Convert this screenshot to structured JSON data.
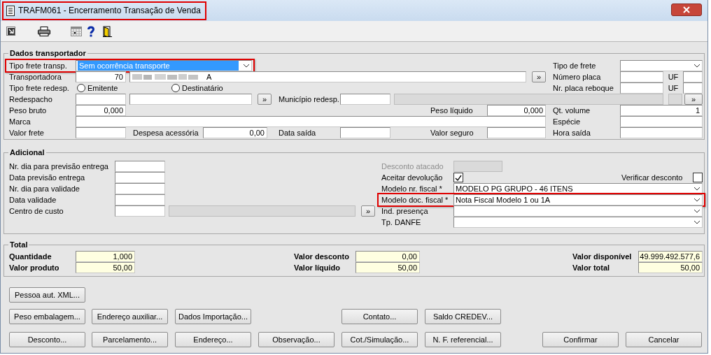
{
  "window": {
    "title": "TRAFM061 - Encerramento Transação de Venda",
    "highlighted": true
  },
  "sections": [
    {
      "title": "Dados transportador",
      "rows": [
        {
          "items": [
            {
              "kind": "label",
              "text": "Tipo frete transp."
            },
            {
              "kind": "combo",
              "value": "Sem ocorrência transporte",
              "selected": true,
              "highlighted": true
            },
            {
              "kind": "label",
              "text": "Tipo de frete"
            },
            {
              "kind": "combo",
              "highlighted": false
            }
          ]
        },
        {
          "items": [
            {
              "kind": "label",
              "text": "Transportadora"
            },
            {
              "kind": "input",
              "value": "70",
              "disabled": false
            },
            {
              "kind": "redacted",
              "value": "A"
            },
            {
              "kind": "button",
              "text": "»"
            },
            {
              "kind": "label",
              "text": "Número placa"
            },
            {
              "kind": "input",
              "disabled": false
            },
            {
              "kind": "label",
              "text": "UF"
            },
            {
              "kind": "input",
              "disabled": false
            }
          ]
        },
        {
          "items": [
            {
              "kind": "label",
              "text": "Tipo frete redesp."
            },
            {
              "kind": "radio",
              "text": "Emitente",
              "selected": false
            },
            {
              "kind": "radio",
              "text": "Destinatário",
              "selected": false
            },
            {
              "kind": "label",
              "text": "Nr. placa reboque"
            },
            {
              "kind": "input",
              "disabled": false
            },
            {
              "kind": "label",
              "text": "UF"
            },
            {
              "kind": "input",
              "disabled": false
            }
          ]
        },
        {
          "items": [
            {
              "kind": "label",
              "text": "Redespacho"
            },
            {
              "kind": "input",
              "disabled": false
            },
            {
              "kind": "input",
              "disabled": false
            },
            {
              "kind": "button",
              "text": "»"
            },
            {
              "kind": "label",
              "text": "Município redesp."
            },
            {
              "kind": "input",
              "disabled": false
            },
            {
              "kind": "input",
              "disabled": true
            },
            {
              "kind": "input",
              "disabled": true
            },
            {
              "kind": "button",
              "text": "»"
            }
          ]
        },
        {
          "items": [
            {
              "kind": "label",
              "text": "Peso bruto"
            },
            {
              "kind": "input",
              "value": "0,000",
              "disabled": false
            },
            {
              "kind": "label",
              "text": "Peso líquido"
            },
            {
              "kind": "input",
              "value": "0,000",
              "disabled": false
            },
            {
              "kind": "label",
              "text": "Qt. volume"
            },
            {
              "kind": "input",
              "value": "1",
              "disabled": false
            }
          ]
        },
        {
          "items": [
            {
              "kind": "label",
              "text": "Marca"
            },
            {
              "kind": "input",
              "disabled": false
            },
            {
              "kind": "label",
              "text": "Espécie"
            },
            {
              "kind": "input",
              "disabled": false
            }
          ]
        },
        {
          "items": [
            {
              "kind": "label",
              "text": "Valor frete"
            },
            {
              "kind": "input",
              "disabled": false
            },
            {
              "kind": "label",
              "text": "Despesa acessória"
            },
            {
              "kind": "input",
              "value": "0,00",
              "disabled": false
            },
            {
              "kind": "label",
              "text": "Data saída"
            },
            {
              "kind": "input",
              "disabled": false
            },
            {
              "kind": "label",
              "text": "Valor seguro"
            },
            {
              "kind": "input",
              "disabled": false
            },
            {
              "kind": "label",
              "text": "Hora saída"
            },
            {
              "kind": "input",
              "disabled": false
            }
          ]
        }
      ]
    },
    {
      "title": "Adicional",
      "rows": [
        {
          "items": [
            {
              "kind": "label",
              "text": "Nr. dia para previsão entrega"
            },
            {
              "kind": "input",
              "disabled": false
            },
            {
              "kind": "label",
              "text": "Desconto atacado",
              "disabled": true
            },
            {
              "kind": "input",
              "disabled": true
            }
          ]
        },
        {
          "items": [
            {
              "kind": "label",
              "text": "Data previsão entrega"
            },
            {
              "kind": "input",
              "disabled": false
            },
            {
              "kind": "label",
              "text": "Aceitar devolução"
            },
            {
              "kind": "check",
              "checked": true
            },
            {
              "kind": "label",
              "text": "Verificar desconto"
            },
            {
              "kind": "check",
              "checked": false
            }
          ]
        },
        {
          "items": [
            {
              "kind": "label",
              "text": "Nr. dia para validade"
            },
            {
              "kind": "input",
              "disabled": false
            },
            {
              "kind": "label",
              "text": "Modelo nr. fiscal *"
            },
            {
              "kind": "combo",
              "value": "MODELO PG GRUPO - 46 ITENS",
              "selected": false,
              "highlighted": false
            }
          ]
        },
        {
          "items": [
            {
              "kind": "label",
              "text": "Data validade"
            },
            {
              "kind": "input",
              "disabled": false
            },
            {
              "kind": "label",
              "text": "Modelo doc. fiscal *"
            },
            {
              "kind": "combo",
              "value": "Nota Fiscal Modelo 1 ou 1A",
              "selected": false,
              "highlighted": true
            }
          ]
        },
        {
          "items": [
            {
              "kind": "label",
              "text": "Centro de custo"
            },
            {
              "kind": "input",
              "disabled": false
            },
            {
              "kind": "input",
              "disabled": true
            },
            {
              "kind": "button",
              "text": "»"
            },
            {
              "kind": "label",
              "text": "Ind. presença"
            },
            {
              "kind": "combo",
              "highlighted": false
            }
          ]
        },
        {
          "items": [
            {
              "kind": "label",
              "text": "Tp. DANFE"
            },
            {
              "kind": "combo",
              "highlighted": false
            }
          ]
        }
      ]
    },
    {
      "title": "Total",
      "rows": [
        {
          "items": [
            {
              "kind": "label",
              "text": "Quantidade"
            },
            {
              "kind": "readonly",
              "value": "1,000"
            },
            {
              "kind": "label",
              "text": "Valor desconto"
            },
            {
              "kind": "readonly",
              "value": "0,00"
            },
            {
              "kind": "label",
              "text": "Valor disponível"
            },
            {
              "kind": "readonly",
              "value": "49.999.492.577,6"
            }
          ]
        },
        {
          "items": [
            {
              "kind": "label",
              "text": "Valor produto"
            },
            {
              "kind": "readonly",
              "value": "50,00"
            },
            {
              "kind": "label",
              "text": "Valor líquido"
            },
            {
              "kind": "readonly",
              "value": "50,00"
            },
            {
              "kind": "label",
              "text": "Valor total"
            },
            {
              "kind": "readonly",
              "value": "50,00"
            }
          ]
        }
      ]
    }
  ],
  "buttons": [
    [
      "Pessoa aut. XML..."
    ],
    [
      "Peso embalagem...",
      "Endereço auxiliar...",
      "Dados Importação...",
      "Contato...",
      "Saldo CREDEV..."
    ],
    [
      "Desconto...",
      "Parcelamento...",
      "Endereço...",
      "Observação...",
      "Cot./Simulação...",
      "N. F. referencial...",
      "Confirmar",
      "Cancelar"
    ]
  ]
}
